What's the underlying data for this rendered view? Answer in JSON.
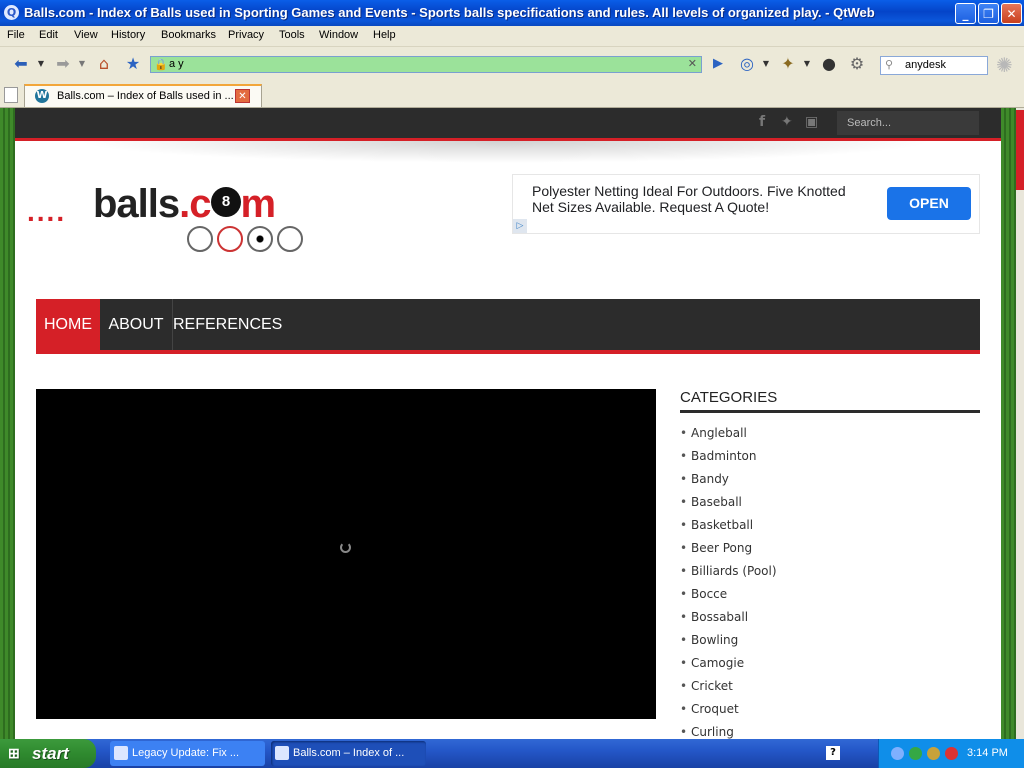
{
  "window": {
    "title": "Balls.com - Index of Balls used in Sporting Games and Events - Sports balls specifications and rules. All levels of organized play. - QtWeb",
    "minimize": "_",
    "maximize": "❐",
    "close": "✕"
  },
  "menu": [
    "File",
    "Edit",
    "View",
    "History",
    "Bookmarks",
    "Privacy",
    "Tools",
    "Window",
    "Help"
  ],
  "toolbar": {
    "url": "a y",
    "search_value": "anydesk"
  },
  "tabs": [
    {
      "label": "Balls.com – Index of Balls used in ...",
      "close": "✕"
    }
  ],
  "site": {
    "search_placeholder": "Search...",
    "logo_dots": "....",
    "logo_balls": "balls",
    "logo_dotcom_red": ".c",
    "logo_8": "8",
    "logo_m": "m",
    "ad_text": "Polyester Netting Ideal For Outdoors. Five Knotted Net Sizes Available. Request A Quote!",
    "ad_button": "OPEN",
    "nav": [
      "HOME",
      "ABOUT",
      "REFERENCES"
    ],
    "categories_title": "CATEGORIES",
    "categories": [
      "Angleball",
      "Badminton",
      "Bandy",
      "Baseball",
      "Basketball",
      "Beer Pong",
      "Billiards (Pool)",
      "Bocce",
      "Bossaball",
      "Bowling",
      "Camogie",
      "Cricket",
      "Croquet",
      "Curling"
    ]
  },
  "taskbar": {
    "start": "start",
    "tasks": [
      "Legacy Update: Fix ...",
      "Balls.com – Index of ..."
    ],
    "clock": "3:14 PM"
  },
  "colors": {
    "accent_red": "#d52027",
    "dark_bar": "#2c2c2c",
    "ad_button_blue": "#1a73e8",
    "xp_blue": "#0A5EE8"
  },
  "icons": [
    "back-icon",
    "forward-icon",
    "home-icon",
    "bookmark-star-icon",
    "lock-icon",
    "go-icon",
    "web-icon",
    "magic-wand-icon",
    "user-icon",
    "settings-icon",
    "search-icon",
    "facebook-icon",
    "twitter-icon",
    "instagram-icon",
    "wordpress-icon"
  ]
}
